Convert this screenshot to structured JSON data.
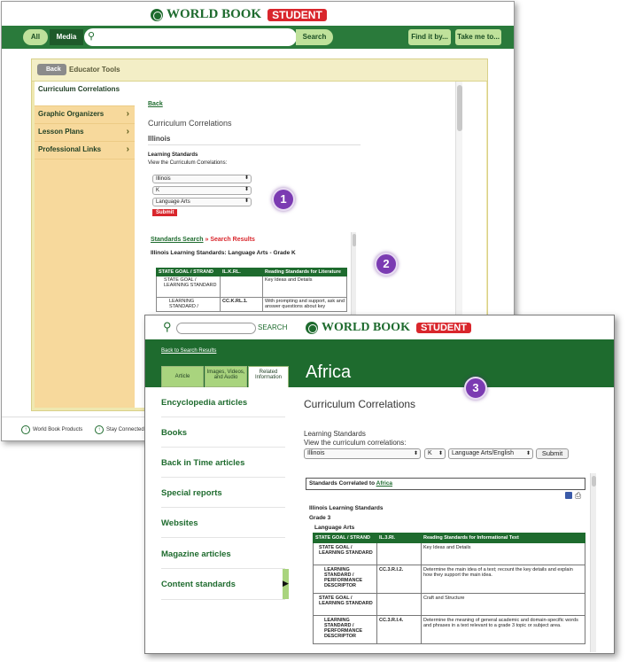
{
  "win1": {
    "logo_text": "WORLD BOOK",
    "logo_badge": "STUDENT",
    "nav": {
      "all": "All",
      "media": "Media",
      "search": "Search",
      "find_it": "Find it by...",
      "take_me": "Take me to..."
    },
    "panel_title": "Educator Tools",
    "back": "Back",
    "sidebar": [
      {
        "label": "Curriculum Correlations"
      },
      {
        "label": "Graphic Organizers"
      },
      {
        "label": "Lesson Plans"
      },
      {
        "label": "Professional Links"
      }
    ],
    "content": {
      "back_link": "Back",
      "heading": "Curriculum Correlations",
      "subheading": "Illinois",
      "ls_label": "Learning Standards",
      "view_label": "View the Curriculum Correlations:",
      "select_state": "Illinois",
      "select_grade": "K",
      "select_subject": "Language Arts",
      "submit": "Submit",
      "crumb_link": "Standards Search",
      "crumb_sep": "»",
      "crumb_current": "Search Results",
      "result_title": "Illinois Learning Standards: Language Arts - Grade K",
      "table": {
        "headers": [
          "STATE GOAL / STRAND",
          "IL.K.RL.",
          "Reading Standards for Literature"
        ],
        "rows": [
          [
            "STATE GOAL / LEARNING STANDARD",
            "",
            "Key Ideas and Details"
          ],
          [
            "LEARNING STANDARD /",
            "CC.K.RL.1.",
            "With prompting and support, ask and answer questions about key"
          ]
        ]
      }
    },
    "footer": {
      "products": "World Book Products",
      "connected": "Stay Connected"
    }
  },
  "win2": {
    "search_label": "SEARCH",
    "logo_text": "WORLD BOOK",
    "logo_badge": "STUDENT",
    "back_results": "Back to Search Results",
    "tabs": [
      "Article",
      "Images, Videos, and Audio",
      "Related Information"
    ],
    "topic": "Africa",
    "left_nav": [
      "Encyclopedia articles",
      "Books",
      "Back in Time articles",
      "Special reports",
      "Websites",
      "Magazine articles",
      "Content standards"
    ],
    "heading": "Curriculum Correlations",
    "ls_label": "Learning Standards",
    "view_label": "View the curriculum correlations:",
    "select_state": "Illinois",
    "select_grade": "K",
    "select_subject": "Language Arts/English",
    "submit": "Submit",
    "correlated_prefix": "Standards Correlated to",
    "correlated_link": "Africa",
    "std_title": "Illinois Learning Standards",
    "grade": "Grade 3",
    "subject": "Language Arts",
    "table": {
      "headers": [
        "STATE GOAL / STRAND",
        "IL.3.RI.",
        "Reading Standards for Informational Text"
      ],
      "rows": [
        [
          "STATE GOAL / LEARNING STANDARD",
          "",
          "Key Ideas and Details"
        ],
        [
          "LEARNING STANDARD / PERFORMANCE DESCRIPTOR",
          "CC.3.R.I.2.",
          "Determine the main idea of a text; recount the key details and explain how they support the main idea."
        ],
        [
          "STATE GOAL / LEARNING STANDARD",
          "",
          "Craft and Structure"
        ],
        [
          "LEARNING STANDARD / PERFORMANCE DESCRIPTOR",
          "CC.3.R.I.4.",
          "Determine the meaning of general academic and domain-specific words and phrases in a text relevant to a grade 3 topic or subject area."
        ]
      ]
    }
  },
  "badges": [
    "1",
    "2",
    "3"
  ],
  "colors": {
    "green": "#1e6b2e",
    "red": "#d9262c",
    "purple": "#7b3bb2",
    "sidebar": "#f7d99c"
  }
}
